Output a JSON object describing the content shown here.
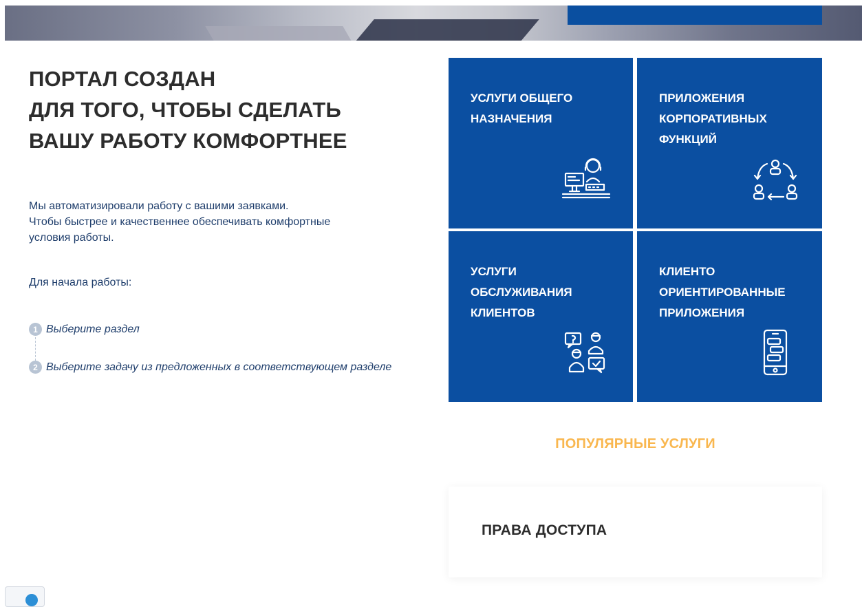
{
  "headline": {
    "line1": "ПОРТАЛ СОЗДАН",
    "line2": "ДЛЯ ТОГО, ЧТОБЫ СДЕЛАТЬ",
    "line3": "ВАШУ РАБОТУ КОМФОРТНЕЕ"
  },
  "intro": {
    "line1": "Мы автоматизировали работу с вашими заявками.",
    "line2": "Чтобы быстрее и качественнее обеспечивать комфортные",
    "line3": "условия работы."
  },
  "start_label": "Для начала работы:",
  "steps": [
    {
      "num": "1",
      "text": "Выберите раздел"
    },
    {
      "num": "2",
      "text": "Выберите задачу из предложенных в соответствующем разделе"
    }
  ],
  "tiles": [
    {
      "title": "УСЛУГИ ОБЩЕГО\nНАЗНАЧЕНИЯ",
      "icon": "operator-at-desk-icon"
    },
    {
      "title": "ПРИЛОЖЕНИЯ\nКОРПОРАТИВНЫХ\nФУНКЦИЙ",
      "icon": "people-cycle-icon"
    },
    {
      "title": "УСЛУГИ\nОБСЛУЖИВАНИЯ\nКЛИЕНТОВ",
      "icon": "customer-support-icon"
    },
    {
      "title": "КЛИЕНТО\nОРИЕНТИРОВАННЫЕ\nПРИЛОЖЕНИЯ",
      "icon": "mobile-chat-icon"
    }
  ],
  "popular": {
    "title": "ПОПУЛЯРНЫЕ УСЛУГИ",
    "items": [
      {
        "label": "ПРАВА ДОСТУПА"
      }
    ]
  },
  "colors": {
    "tile_bg": "#0b4fa1",
    "accent": "#f9b74f",
    "text_dark": "#2d2d2d",
    "text_blue": "#1e3d6b"
  },
  "widgets": {
    "telegram_icon": "telegram-icon"
  }
}
